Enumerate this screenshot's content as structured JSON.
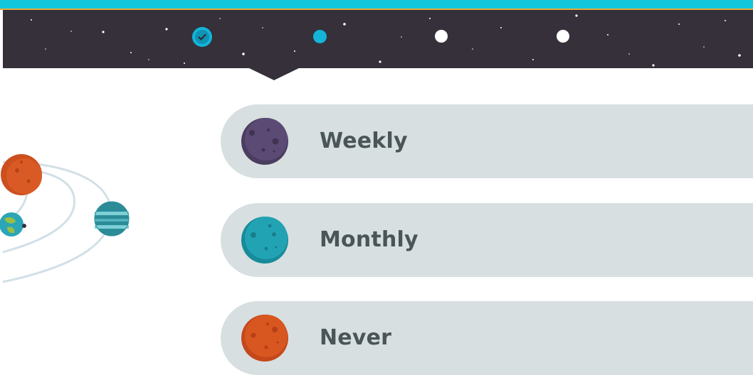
{
  "progress": {
    "steps": [
      {
        "state": "completed",
        "icon": "check-icon"
      },
      {
        "state": "current"
      },
      {
        "state": "upcoming"
      },
      {
        "state": "upcoming"
      }
    ]
  },
  "colors": {
    "accent": "#12b5d8",
    "space_background": "#353039",
    "option_background": "#d7dfe1",
    "option_text": "#4a5558",
    "gold_line": "#e8a93a"
  },
  "options": [
    {
      "label": "Weekly",
      "icon": "purple-planet-icon",
      "color": "#54476b"
    },
    {
      "label": "Monthly",
      "icon": "teal-planet-icon",
      "color": "#1e9fb0"
    },
    {
      "label": "Never",
      "icon": "orange-planet-icon",
      "color": "#d4511f"
    }
  ]
}
